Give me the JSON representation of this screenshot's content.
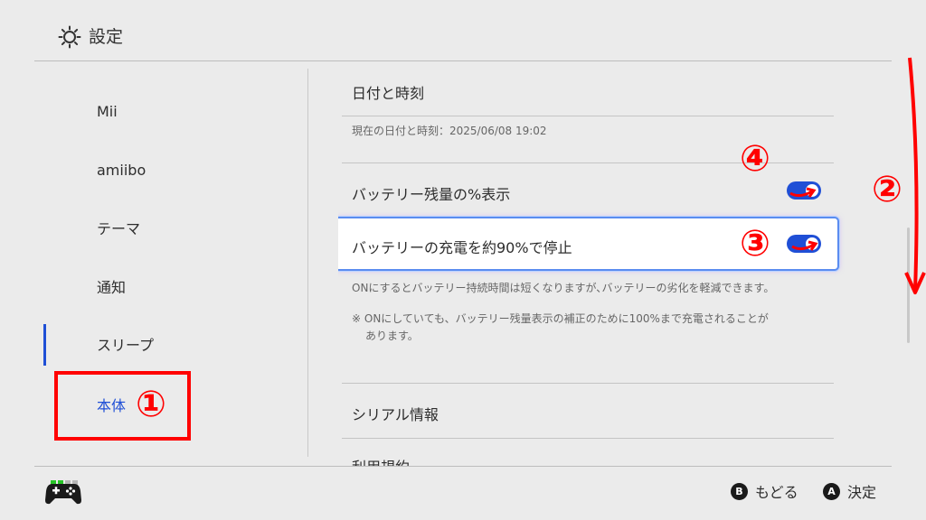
{
  "header": {
    "title": "設定",
    "icon": "gear-icon"
  },
  "sidebar": {
    "items": [
      {
        "label": "Mii"
      },
      {
        "label": "amiibo"
      },
      {
        "label": "テーマ"
      },
      {
        "label": "通知"
      },
      {
        "label": "スリープ"
      },
      {
        "label": "本体",
        "selected": true
      }
    ]
  },
  "content": {
    "datetime_label": "日付と時刻",
    "datetime_value": "現在の日付と時刻：2025/06/08 19:02",
    "battery_percent_label": "バッテリー残量の%表示",
    "battery_percent_on": true,
    "battery_limit_label": "バッテリーの充電を約90%で停止",
    "battery_limit_on": true,
    "battery_limit_desc": "ONにするとバッテリー持続時間は短くなりますが､バッテリーの劣化を軽減できます。",
    "battery_limit_note_line1": "※ ONにしていても、バッテリー残量表示の補正のために100%まで充電されることが",
    "battery_limit_note_line2": "あります。",
    "serial_label": "シリアル情報",
    "terms_label": "利用規約"
  },
  "footer": {
    "back_button": "B",
    "back_label": "もどる",
    "confirm_button": "A",
    "confirm_label": "決定"
  },
  "annotations": {
    "m1": "①",
    "m2": "②",
    "m3": "③",
    "m4": "④"
  },
  "colors": {
    "accent": "#1f4fd6",
    "annotation": "#ff0000",
    "background": "#ebebeb"
  }
}
